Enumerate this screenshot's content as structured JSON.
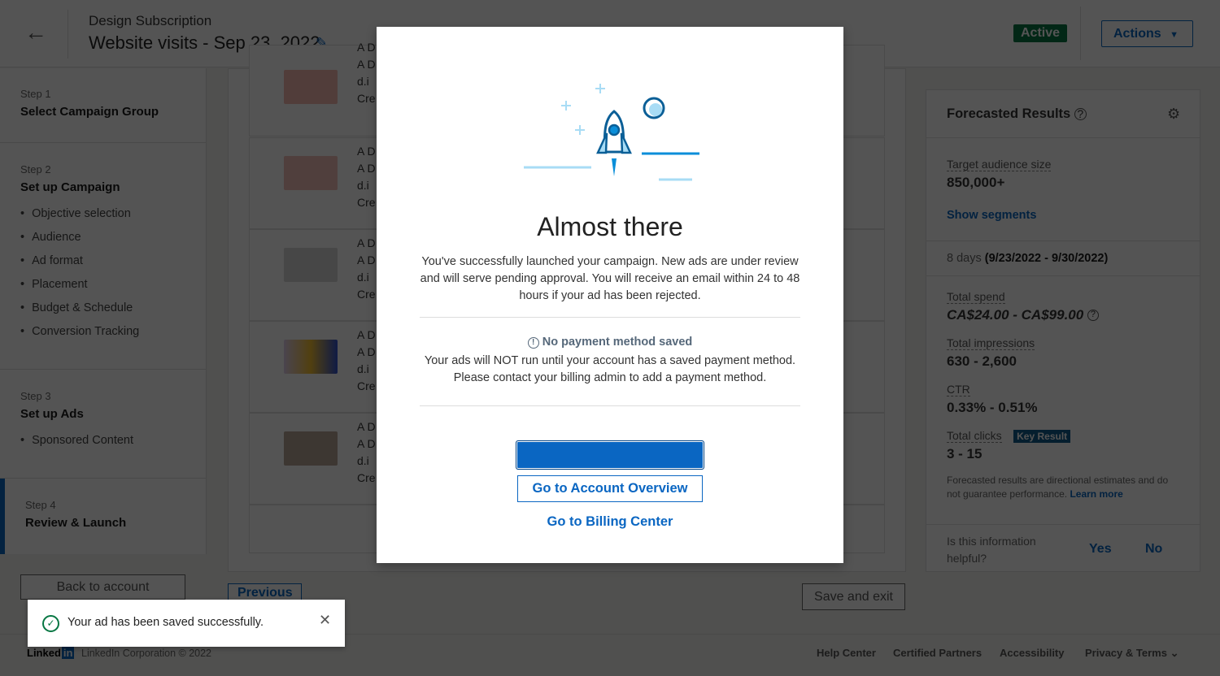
{
  "header": {
    "subtitle": "Design Subscription",
    "title": "Website visits - Sep 23, 2022",
    "status": "Active",
    "actions_label": "Actions"
  },
  "sidebar": {
    "steps": [
      {
        "step": "Step 1",
        "name": "Select Campaign Group",
        "items": []
      },
      {
        "step": "Step 2",
        "name": "Set up Campaign",
        "items": [
          "Objective selection",
          "Audience",
          "Ad format",
          "Placement",
          "Budget & Schedule",
          "Conversion Tracking"
        ]
      },
      {
        "step": "Step 3",
        "name": "Set up Ads",
        "items": [
          "Sponsored Content"
        ]
      },
      {
        "step": "Step 4",
        "name": "Review & Launch",
        "items": []
      }
    ],
    "back_label": "Back to account"
  },
  "ads": [
    {
      "lines": "A D\nA D\nd.i\nCre"
    },
    {
      "lines": "A D\nA D\nd.i\nCre"
    },
    {
      "lines": "A D\nA D\nd.i\nCre"
    },
    {
      "lines": "A D\nA D\nd.i\nCre"
    },
    {
      "lines": "A D\nA D\nd.i\nCre"
    }
  ],
  "nav": {
    "previous": "Previous",
    "save_exit": "Save and exit"
  },
  "forecast": {
    "title": "Forecasted Results",
    "audience_label": "Target audience size",
    "audience_value": "850,000+",
    "show_segments": "Show segments",
    "days": "8 days",
    "range": "(9/23/2022 - 9/30/2022)",
    "spend_label": "Total spend",
    "spend_value": "CA$24.00 - CA$99.00",
    "impr_label": "Total impressions",
    "impr_value": "630 - 2,600",
    "ctr_label": "CTR",
    "ctr_value": "0.33% - 0.51%",
    "clicks_label": "Total clicks",
    "key_result": "Key Result",
    "clicks_value": "3 - 15",
    "disclaimer": "Forecasted results are directional estimates and do not guarantee performance.",
    "learn_more": "Learn more",
    "helpful_q": "Is this information helpful?",
    "yes": "Yes",
    "no": "No"
  },
  "modal": {
    "title": "Almost there",
    "body": "You've successfully launched your campaign. New ads are under review and will serve pending approval. You will receive an email within 24 to 48 hours if your ad has been rejected.",
    "warning_title": "No payment method saved",
    "warning_line1": "Your ads will NOT run until your account has a saved payment method.",
    "warning_line2": "Please contact your billing admin to add a payment method.",
    "account_btn": "Go to Account Overview",
    "billing_link": "Go to Billing Center"
  },
  "toast": {
    "message": "Your ad has been saved successfully."
  },
  "footer": {
    "logo": "LinkedIn",
    "copyright": "LinkedIn Corporation © 2022",
    "links": [
      "Help Center",
      "Certified Partners",
      "Accessibility",
      "Privacy & Terms"
    ]
  },
  "colors": {
    "brand": "#0a66c2",
    "active": "#057642",
    "success": "#057642"
  }
}
